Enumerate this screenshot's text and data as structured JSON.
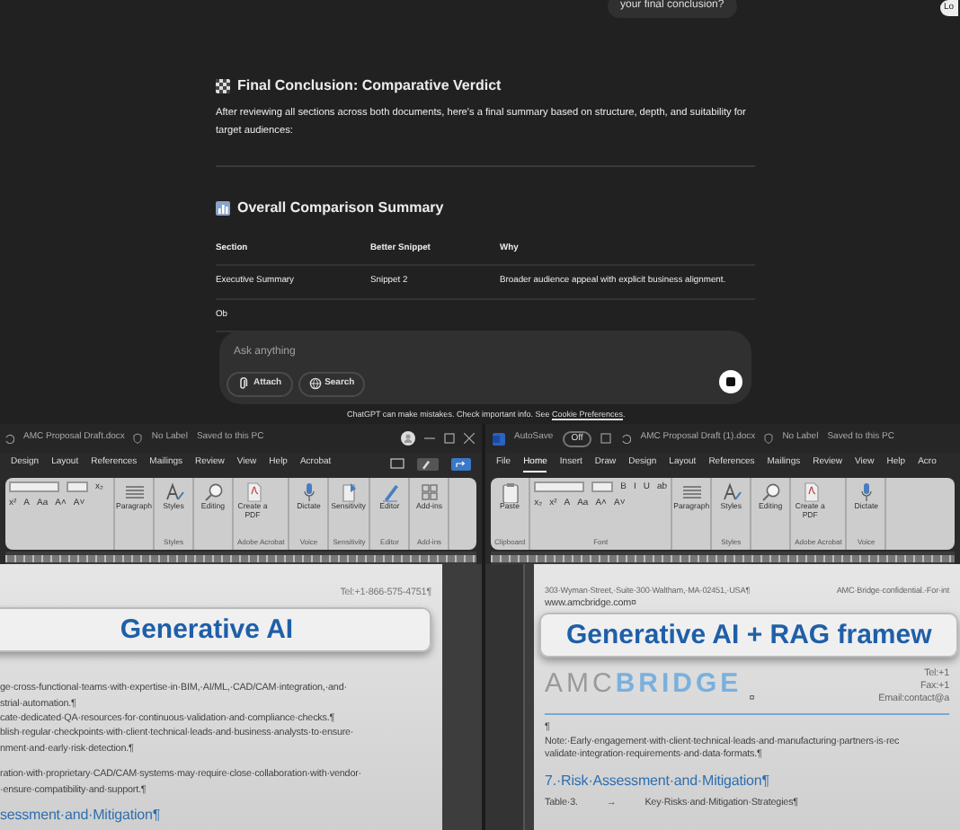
{
  "chat": {
    "user_message": "your final conclusion?",
    "edge_button": "Lo",
    "conclusion": {
      "heading": "Final Conclusion: Comparative Verdict",
      "text": "After reviewing all sections across both documents, here's a final summary based on structure, depth, and suitability for target audiences:"
    },
    "summary": {
      "heading": "Overall Comparison Summary",
      "columns": [
        "Section",
        "Better Snippet",
        "Why"
      ],
      "rows": [
        [
          "Executive Summary",
          "Snippet 2",
          "Broader audience appeal with explicit business alignment."
        ],
        [
          "Ob"
        ]
      ]
    },
    "composer": {
      "placeholder": "Ask anything",
      "buttons": [
        {
          "kind": "attach",
          "label": "Attach"
        },
        {
          "kind": "search",
          "label": "Search"
        }
      ]
    },
    "disclaimer": {
      "text": "ChatGPT can make mistakes. Check important info. See",
      "link": "Cookie Preferences",
      "end": "."
    }
  },
  "windows": [
    {
      "title": "AMC Proposal Draft.docx",
      "label": "No Label",
      "saved": "Saved to this PC",
      "tabs": [
        {
          "label": "Design",
          "selected": false
        },
        {
          "label": "Layout",
          "selected": false
        },
        {
          "label": "References",
          "selected": false
        },
        {
          "label": "Mailings",
          "selected": false
        },
        {
          "label": "Review",
          "selected": false
        },
        {
          "label": "View",
          "selected": false
        },
        {
          "label": "Help",
          "selected": false
        },
        {
          "label": "Acrobat",
          "selected": false
        }
      ],
      "ribbon": [
        {
          "kind": "font",
          "buttons": [
            "x₂",
            "x²",
            "A",
            "Aa",
            "A˄",
            "A˅"
          ]
        },
        {
          "kind": "tools",
          "buttons": [
            {
              "kind": "paragraph",
              "label": "Paragraph"
            }
          ]
        },
        {
          "kind": "tools",
          "label": "Styles",
          "buttons": [
            {
              "kind": "styles",
              "label": "Styles"
            }
          ]
        },
        {
          "kind": "tools",
          "buttons": [
            {
              "kind": "editing",
              "label": "Editing"
            }
          ]
        },
        {
          "kind": "tools",
          "label": "Adobe Acrobat",
          "buttons": [
            {
              "kind": "pdf",
              "label": "Create a PDF"
            }
          ]
        },
        {
          "kind": "tools",
          "label": "Voice",
          "buttons": [
            {
              "kind": "mic",
              "label": "Dictate"
            }
          ]
        },
        {
          "kind": "tools",
          "label": "Sensitivity",
          "buttons": [
            {
              "kind": "sensitivity",
              "label": "Sensitivity"
            }
          ]
        },
        {
          "kind": "tools",
          "label": "Editor",
          "buttons": [
            {
              "kind": "editor",
              "label": "Editor"
            }
          ]
        },
        {
          "kind": "tools",
          "label": "Add-ins",
          "buttons": [
            {
              "kind": "addins",
              "label": "Add-ins"
            }
          ]
        }
      ],
      "banner": "Generative AI",
      "blocks": [
        {
          "kind": "meta",
          "text": "Tel:+1-866-575-4751¶"
        },
        {
          "kind": "body",
          "text": "ge·cross-functional·teams·with·expertise·in·BIM,·AI/ML,·CAD/CAM·integration,·and·"
        },
        {
          "kind": "body",
          "text": "strial·automation.¶"
        },
        {
          "kind": "body",
          "text": "cate·dedicated·QA·resources·for·continuous·validation·and·compliance·checks.¶"
        },
        {
          "kind": "body",
          "text": "blish·regular·checkpoints·with·client·technical·leads·and·business·analysts·to·ensure·"
        },
        {
          "kind": "body",
          "text": "nment·and·early·risk·detection.¶"
        },
        {
          "kind": "spacer"
        },
        {
          "kind": "body",
          "text": "ration·with·proprietary·CAD/CAM·systems·may·require·close·collaboration·with·vendor·"
        },
        {
          "kind": "body",
          "text": "·ensure·compatibility·and·support.¶"
        },
        {
          "kind": "heading",
          "text": "sessment·and·Mitigation¶"
        }
      ]
    },
    {
      "autosave": {
        "label": "AutoSave",
        "state": "Off"
      },
      "title": "AMC Proposal Draft (1).docx",
      "label": "No Label",
      "saved": "Saved to this PC",
      "tabs": [
        {
          "label": "File",
          "selected": false
        },
        {
          "label": "Home",
          "selected": true
        },
        {
          "label": "Insert",
          "selected": false
        },
        {
          "label": "Draw",
          "selected": false
        },
        {
          "label": "Design",
          "selected": false
        },
        {
          "label": "Layout",
          "selected": false
        },
        {
          "label": "References",
          "selected": false
        },
        {
          "label": "Mailings",
          "selected": false
        },
        {
          "label": "Review",
          "selected": false
        },
        {
          "label": "View",
          "selected": false
        },
        {
          "label": "Help",
          "selected": false
        },
        {
          "label": "Acro",
          "selected": false
        }
      ],
      "ribbon": [
        {
          "kind": "tools",
          "label": "Clipboard",
          "buttons": [
            {
              "kind": "paste",
              "label": "Paste"
            }
          ]
        },
        {
          "kind": "font",
          "label": "Font",
          "buttons": [
            "B",
            "I",
            "U",
            "ab",
            "x₂",
            "x²",
            "A",
            "Aa",
            "A˄",
            "A˅"
          ]
        },
        {
          "kind": "tools",
          "buttons": [
            {
              "kind": "paragraph",
              "label": "Paragraph"
            }
          ]
        },
        {
          "kind": "tools",
          "label": "Styles",
          "buttons": [
            {
              "kind": "styles",
              "label": "Styles"
            }
          ]
        },
        {
          "kind": "tools",
          "buttons": [
            {
              "kind": "editing",
              "label": "Editing"
            }
          ]
        },
        {
          "kind": "tools",
          "label": "Adobe Acrobat",
          "buttons": [
            {
              "kind": "pdf",
              "label": "Create a PDF"
            }
          ]
        },
        {
          "kind": "tools",
          "label": "Voice",
          "buttons": [
            {
              "kind": "mic",
              "label": "Dictate"
            }
          ]
        }
      ],
      "banner": "Generative AI + RAG framew",
      "blocks": [
        {
          "kind": "address",
          "text": "303·Wyman·Street,·Suite·300·Waltham,·MA·02451,·USA¶",
          "aside": "AMC·Bridge·confidential.·For·int"
        },
        {
          "kind": "body",
          "text": "www.amcbridge.com¤"
        },
        {
          "kind": "logo",
          "parts": [
            "AMC",
            "BRIDGE"
          ],
          "mark": "¤",
          "contacts": [
            "Tel:+1",
            "Fax:+1",
            "Email:contact@a"
          ]
        },
        {
          "kind": "body",
          "text": "¶"
        },
        {
          "kind": "body",
          "text": "Note:·Early·engagement·with·client·technical·leads·and·manufacturing·partners·is·rec"
        },
        {
          "kind": "body",
          "text": "validate·integration·requirements·and·data·formats.¶"
        },
        {
          "kind": "heading",
          "text": "7.·Risk·Assessment·and·Mitigation¶"
        },
        {
          "kind": "caption",
          "label": "Table·3.",
          "arrow": "→",
          "text": "Key·Risks·and·Mitigation·Strategies¶"
        }
      ]
    }
  ]
}
